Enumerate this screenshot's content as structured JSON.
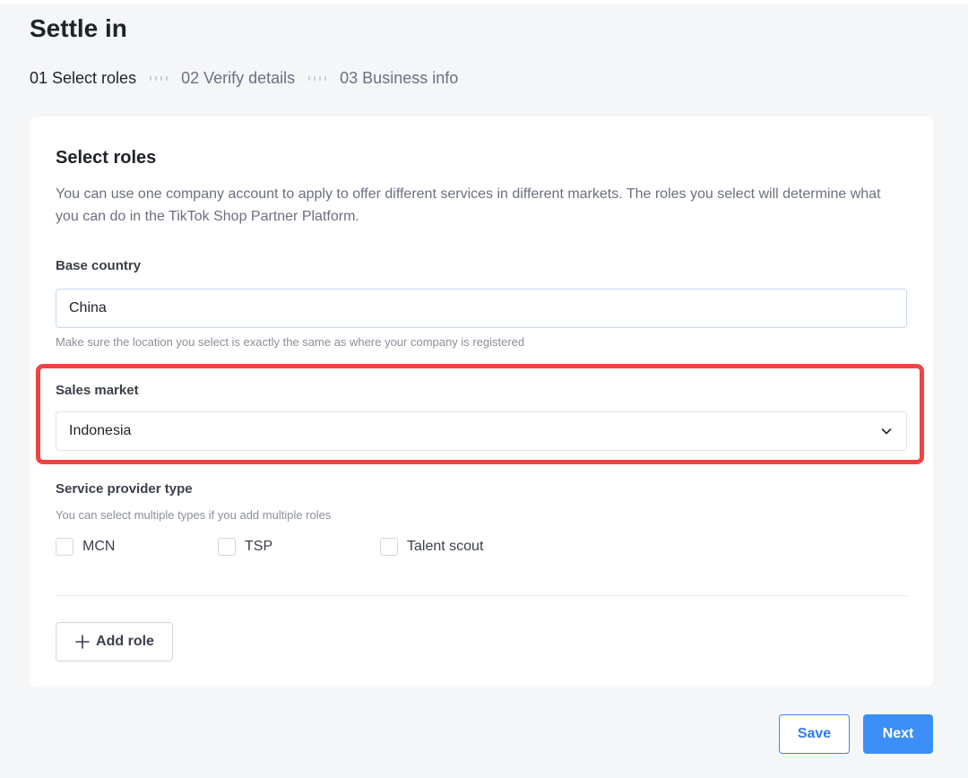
{
  "page": {
    "title": "Settle in"
  },
  "steps": [
    {
      "label": "01 Select roles",
      "active": true
    },
    {
      "label": "02 Verify details",
      "active": false
    },
    {
      "label": "03 Business info",
      "active": false
    }
  ],
  "card": {
    "title": "Select roles",
    "description": "You can use one company account to apply to offer different services in different markets. The roles you select will determine what you can do in the TikTok Shop Partner Platform.",
    "base_country": {
      "label": "Base country",
      "value": "China",
      "hint": "Make sure the location you select is exactly the same as where your company is registered"
    },
    "sales_market": {
      "label": "Sales market",
      "value": "Indonesia",
      "icon": "chevron-down-icon"
    },
    "service_provider": {
      "label": "Service provider type",
      "hint": "You can select multiple types if you add multiple roles",
      "options": [
        {
          "label": "MCN",
          "checked": false
        },
        {
          "label": "TSP",
          "checked": false
        },
        {
          "label": "Talent scout",
          "checked": false
        }
      ]
    },
    "add_role_label": "Add role"
  },
  "footer": {
    "save_label": "Save",
    "next_label": "Next"
  },
  "colors": {
    "accent": "#3b8ff6",
    "highlight": "#ef4444"
  }
}
